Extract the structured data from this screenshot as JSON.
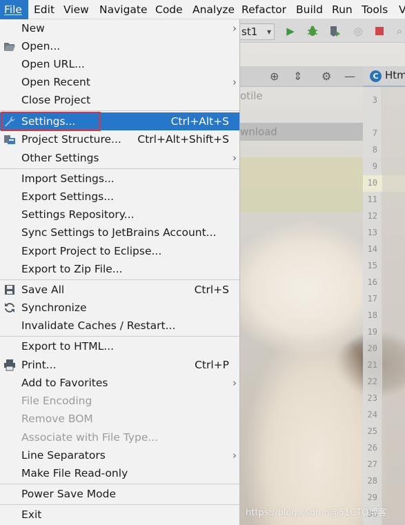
{
  "menubar": {
    "items": [
      "File",
      "Edit",
      "View",
      "Navigate",
      "Code",
      "Analyze",
      "Refactor",
      "Build",
      "Run",
      "Tools",
      "V"
    ]
  },
  "background": {
    "run_config": "st1",
    "panel_text_1": "otile",
    "panel_text_2": "wnload",
    "editor_tab": "Htm",
    "line_numbers": [
      "3",
      "7",
      "8",
      "9",
      "10",
      "11",
      "12",
      "13",
      "14",
      "15",
      "16",
      "17",
      "18",
      "19",
      "20",
      "21",
      "22",
      "23",
      "24",
      "25",
      "26",
      "27",
      "28",
      "29",
      "30"
    ],
    "highlighted_line": "11",
    "watermark": "https://blog.csdn.n@51CTO博客"
  },
  "menu": {
    "items": [
      {
        "label": "New",
        "submenu": true
      },
      {
        "label": "Open...",
        "icon": "folder-open-icon"
      },
      {
        "label": "Open URL..."
      },
      {
        "label": "Open Recent",
        "submenu": true
      },
      {
        "label": "Close Project"
      },
      {
        "label": "Settings...",
        "shortcut": "Ctrl+Alt+S",
        "icon": "wrench-icon",
        "selected": true
      },
      {
        "label": "Project Structure...",
        "shortcut": "Ctrl+Alt+Shift+S",
        "icon": "project-structure-icon"
      },
      {
        "label": "Other Settings",
        "submenu": true
      },
      {
        "label": "Import Settings..."
      },
      {
        "label": "Export Settings..."
      },
      {
        "label": "Settings Repository..."
      },
      {
        "label": "Sync Settings to JetBrains Account..."
      },
      {
        "label": "Export Project to Eclipse..."
      },
      {
        "label": "Export to Zip File..."
      },
      {
        "label": "Save All",
        "shortcut": "Ctrl+S",
        "icon": "save-icon"
      },
      {
        "label": "Synchronize",
        "icon": "sync-icon"
      },
      {
        "label": "Invalidate Caches / Restart..."
      },
      {
        "label": "Export to HTML..."
      },
      {
        "label": "Print...",
        "shortcut": "Ctrl+P",
        "icon": "printer-icon"
      },
      {
        "label": "Add to Favorites",
        "submenu": true
      },
      {
        "label": "File Encoding",
        "disabled": true
      },
      {
        "label": "Remove BOM",
        "disabled": true
      },
      {
        "label": "Associate with File Type...",
        "disabled": true
      },
      {
        "label": "Line Separators",
        "submenu": true
      },
      {
        "label": "Make File Read-only"
      },
      {
        "label": "Power Save Mode"
      },
      {
        "label": "Exit"
      }
    ]
  },
  "colors": {
    "selection": "#2676c9",
    "highlight_box": "#e0343a",
    "menu_bg": "#f2f2f2",
    "disabled_text": "#9b9b9b"
  }
}
